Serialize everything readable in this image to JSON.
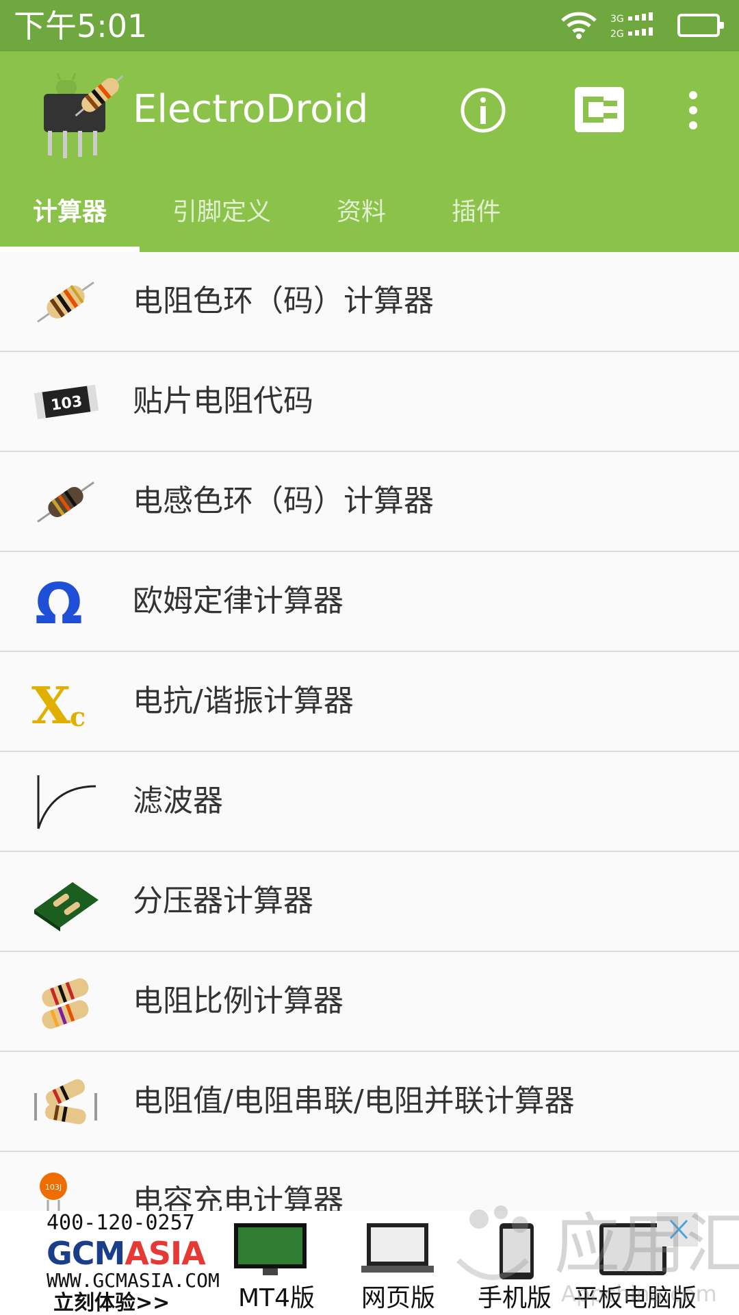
{
  "status_bar": {
    "time": "下午5:01",
    "network_label_top": "3G",
    "network_label_bottom": "2G"
  },
  "app_bar": {
    "title": "ElectroDroid"
  },
  "tabs": [
    {
      "label": "计算器",
      "active": true
    },
    {
      "label": "引脚定义",
      "active": false
    },
    {
      "label": "资料",
      "active": false
    },
    {
      "label": "插件",
      "active": false
    }
  ],
  "list": {
    "items": [
      {
        "label": "电阻色环（码）计算器",
        "icon": "resistor-icon"
      },
      {
        "label": "贴片电阻代码",
        "icon": "smd-resistor-icon",
        "icon_text": "103"
      },
      {
        "label": "电感色环（码）计算器",
        "icon": "inductor-icon"
      },
      {
        "label": "欧姆定律计算器",
        "icon": "omega-icon",
        "icon_text": "Ω"
      },
      {
        "label": "电抗/谐振计算器",
        "icon": "reactance-icon",
        "icon_text": "X",
        "icon_subtext": "c"
      },
      {
        "label": "滤波器",
        "icon": "filter-curve-icon"
      },
      {
        "label": "分压器计算器",
        "icon": "voltage-divider-icon"
      },
      {
        "label": "电阻比例计算器",
        "icon": "resistor-ratio-icon"
      },
      {
        "label": "电阻值/电阻串联/电阻并联计算器",
        "icon": "resistor-network-icon"
      },
      {
        "label": "电容充电计算器",
        "icon": "capacitor-icon",
        "icon_text": "103J"
      }
    ]
  },
  "ad": {
    "phone": "400-120-0257",
    "brand_main": "GCM",
    "brand_accent": "ASIA",
    "url": "WWW.GCMASIA.COM",
    "cta": "立刻体验>>",
    "captions": [
      "MT4版",
      "网页版",
      "手机版",
      "平板电脑版"
    ]
  },
  "watermark": {
    "text": "应用汇",
    "subtext": "Appchina.com"
  },
  "colors": {
    "status_bar": "#6fa83e",
    "app_bar": "#8bc34a",
    "list_bg": "#fafafa",
    "divider": "#dcdcdc"
  }
}
